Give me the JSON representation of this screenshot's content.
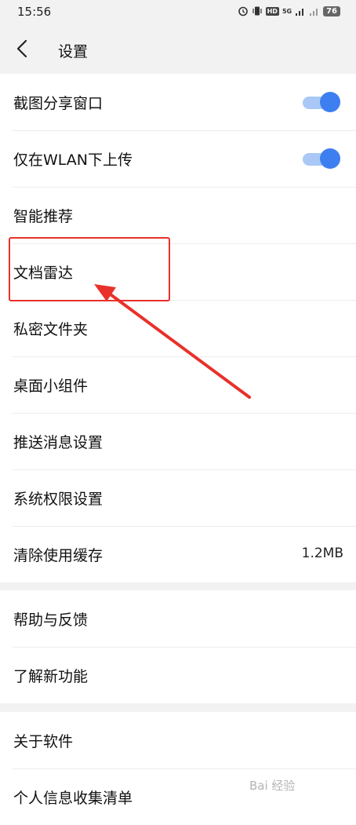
{
  "statusbar": {
    "time": "15:56",
    "hd": "HD",
    "signal": "5G",
    "battery": "76"
  },
  "header": {
    "title": "设置"
  },
  "group1": [
    {
      "label": "截图分享窗口",
      "toggle": true
    },
    {
      "label": "仅在WLAN下上传",
      "toggle": true
    },
    {
      "label": "智能推荐"
    },
    {
      "label": "文档雷达"
    },
    {
      "label": "私密文件夹"
    },
    {
      "label": "桌面小组件"
    },
    {
      "label": "推送消息设置"
    },
    {
      "label": "系统权限设置"
    },
    {
      "label": "清除使用缓存",
      "value": "1.2MB"
    }
  ],
  "group2": [
    {
      "label": "帮助与反馈"
    },
    {
      "label": "了解新功能"
    }
  ],
  "group3": [
    {
      "label": "关于软件"
    },
    {
      "label": "个人信息收集清单"
    }
  ],
  "colors": {
    "accent": "#3d7ff0",
    "toggle_track": "#a9c8f5",
    "annotation": "#e8312a"
  },
  "watermark": "Bai 经验"
}
